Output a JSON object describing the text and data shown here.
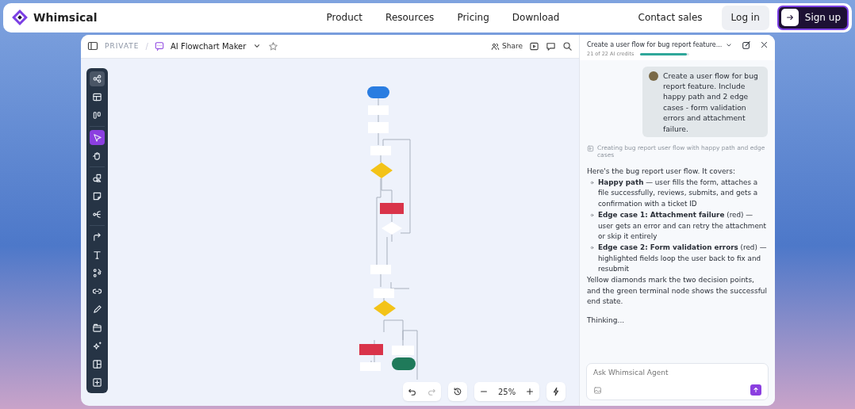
{
  "nav": {
    "logo": "Whimsical",
    "links": [
      "Product",
      "Resources",
      "Pricing",
      "Download"
    ],
    "contact": "Contact sales",
    "login": "Log in",
    "signup": "Sign up"
  },
  "board": {
    "breadcrumb": "PRIVATE",
    "separator": "/",
    "title": "AI Flowchart Maker",
    "share": "Share",
    "zoom": "25%"
  },
  "tools": [
    {
      "selected": true
    },
    {
      "selected": false
    },
    {
      "selected": false
    },
    {
      "selected": true
    },
    {
      "selected": false
    },
    {
      "selected": false
    },
    {
      "selected": false
    },
    {
      "selected": false
    },
    {
      "selected": false
    },
    {
      "selected": false
    },
    {
      "selected": false
    },
    {
      "selected": false
    },
    {
      "selected": false
    },
    {
      "selected": false
    },
    {
      "selected": false
    },
    {
      "selected": false
    },
    {
      "selected": false
    }
  ],
  "chat": {
    "title": "Create a user flow for bug report feature...",
    "credits": "21 of 22 AI credits",
    "credits_meter": {
      "level": 0.95
    },
    "user_message": "Create a user flow for bug report feature. Include happy path and 2 edge cases - form validation errors and attachment failure.",
    "status": "Creating bug report user flow with happy path and edge cases",
    "intro": "Here's the bug report user flow. It covers:",
    "bullets": [
      "**Happy path** — user fills the form, attaches a file successfully, reviews, submits, and gets a confirmation with a ticket ID",
      "**Edge case 1: Attachment failure** (red) — user gets an error and can retry the attachment or skip it entirely",
      "**Edge case 2: Form validation errors** (red) — highlighted fields loop the user back to fix and resubmit"
    ],
    "outro": "Yellow diamonds mark the two decision points, and the green terminal node shows the successful end state.",
    "thinking": "Thinking...",
    "placeholder": "Ask Whimsical Agent"
  }
}
